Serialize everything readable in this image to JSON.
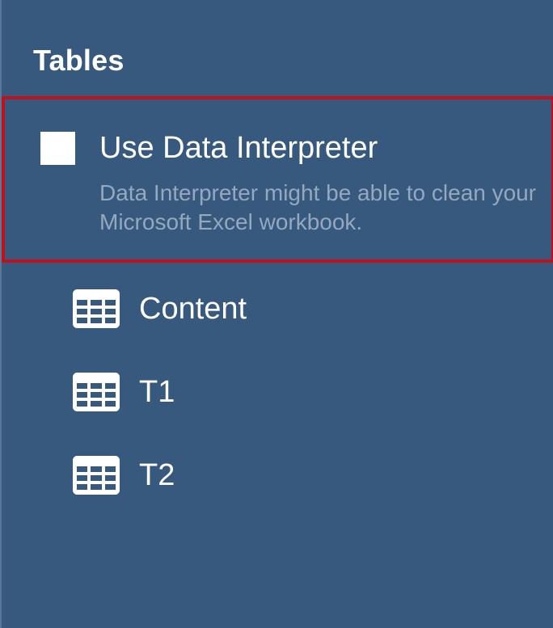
{
  "panel": {
    "title": "Tables",
    "background_color": "#36597d",
    "highlight_border_color": "#c0101b"
  },
  "data_interpreter": {
    "label": "Use Data Interpreter",
    "description": "Data Interpreter might be able to clean your Microsoft Excel workbook.",
    "checked": false
  },
  "tables": [
    {
      "label": "Content",
      "icon": "table-grid-icon"
    },
    {
      "label": "T1",
      "icon": "table-grid-icon"
    },
    {
      "label": "T2",
      "icon": "table-grid-icon"
    }
  ]
}
